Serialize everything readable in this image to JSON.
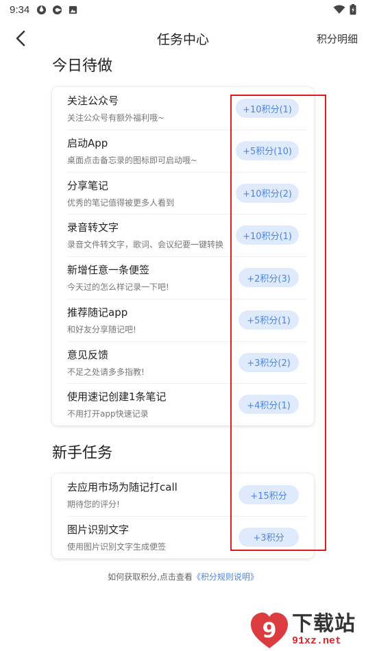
{
  "status_bar": {
    "time": "9:34"
  },
  "header": {
    "title": "任务中心",
    "right_link": "积分明细"
  },
  "sections": {
    "daily": {
      "title": "今日待做",
      "tasks": [
        {
          "title": "关注公众号",
          "desc": "关注公众号有额外福利哦~",
          "reward": "+10积分(1)"
        },
        {
          "title": "启动App",
          "desc": "桌面点击备忘录的图标即可启动哦~",
          "reward": "+5积分(10)"
        },
        {
          "title": "分享笔记",
          "desc": "优秀的笔记值得被更多人看到",
          "reward": "+10积分(2)"
        },
        {
          "title": "录音转文字",
          "desc": "录音文件转文字，歌词、会议纪要一键转换",
          "reward": "+10积分(1)"
        },
        {
          "title": "新增任意一条便签",
          "desc": "今天过的怎么样记录一下吧!",
          "reward": "+2积分(3)"
        },
        {
          "title": "推荐随记app",
          "desc": "和好友分享随记吧!",
          "reward": "+5积分(1)"
        },
        {
          "title": "意见反馈",
          "desc": "不足之处请多多指教!",
          "reward": "+3积分(2)"
        },
        {
          "title": "使用速记创建1条笔记",
          "desc": "不用打开app快速记录",
          "reward": "+4积分(1)"
        }
      ]
    },
    "newbie": {
      "title": "新手任务",
      "tasks": [
        {
          "title": "去应用市场为随记打call",
          "desc": "期待您的评分!",
          "reward": "+15积分"
        },
        {
          "title": "图片识别文字",
          "desc": "使用图片识别文字生成便签",
          "reward": "+3积分"
        }
      ]
    }
  },
  "footer": {
    "prefix": "如何获取积分,点击查看",
    "link": "《积分规则说明》"
  },
  "watermark": {
    "text": "下载站",
    "domain": "91xz.net",
    "logo": "9"
  },
  "colors": {
    "accent": "#4c84e6",
    "pill_bg": "#dfeafc",
    "highlight": "#e01b1b",
    "watermark_red": "#d8262b"
  }
}
